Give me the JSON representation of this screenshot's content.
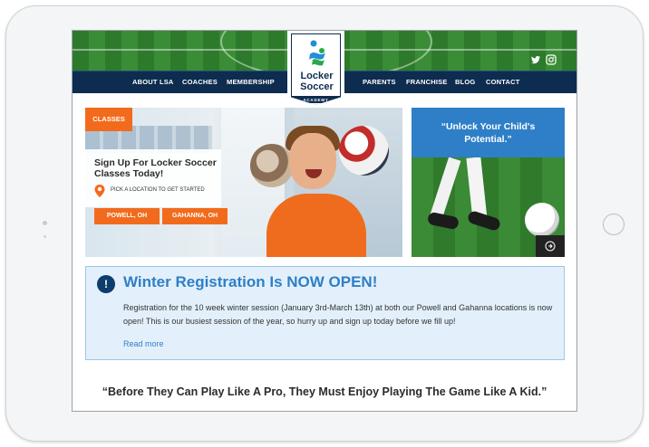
{
  "nav": {
    "left": [
      "ABOUT LSA",
      "COACHES",
      "MEMBERSHIP"
    ],
    "right": [
      "PARENTS",
      "FRANCHISE",
      "BLOG",
      "CONTACT"
    ]
  },
  "logo": {
    "line1": "Locker",
    "line2": "Soccer",
    "band": "ACADEMY"
  },
  "social": {
    "icons": [
      "twitter-icon",
      "instagram-icon"
    ]
  },
  "hero": {
    "tag": "CLASSES",
    "title": "Sign Up For Locker Soccer Classes Today!",
    "pin_label": "PICK A LOCATION TO GET STARTED",
    "locations": [
      "POWELL, OH",
      "GAHANNA, OH"
    ]
  },
  "promo": {
    "text": "“Unlock Your Child's Potential.”",
    "arrow_icon": "arrow-right-icon"
  },
  "notice": {
    "icon_text": "!",
    "title": "Winter Registration Is NOW OPEN!",
    "body": "Registration for the 10 week winter session (January 3rd-March 13th) at both our Powell and Gahanna locations is now open! This is our busiest session of the year, so hurry up and sign up today before we fill up!",
    "link": "Read more"
  },
  "quote": "“Before They Can Play Like A Pro, They Must Enjoy Playing The Game Like A Kid.”",
  "colors": {
    "navy": "#0d2c4f",
    "orange": "#f26b1d",
    "blue": "#2e7fc7",
    "notice_bg": "#e3f0fb"
  }
}
